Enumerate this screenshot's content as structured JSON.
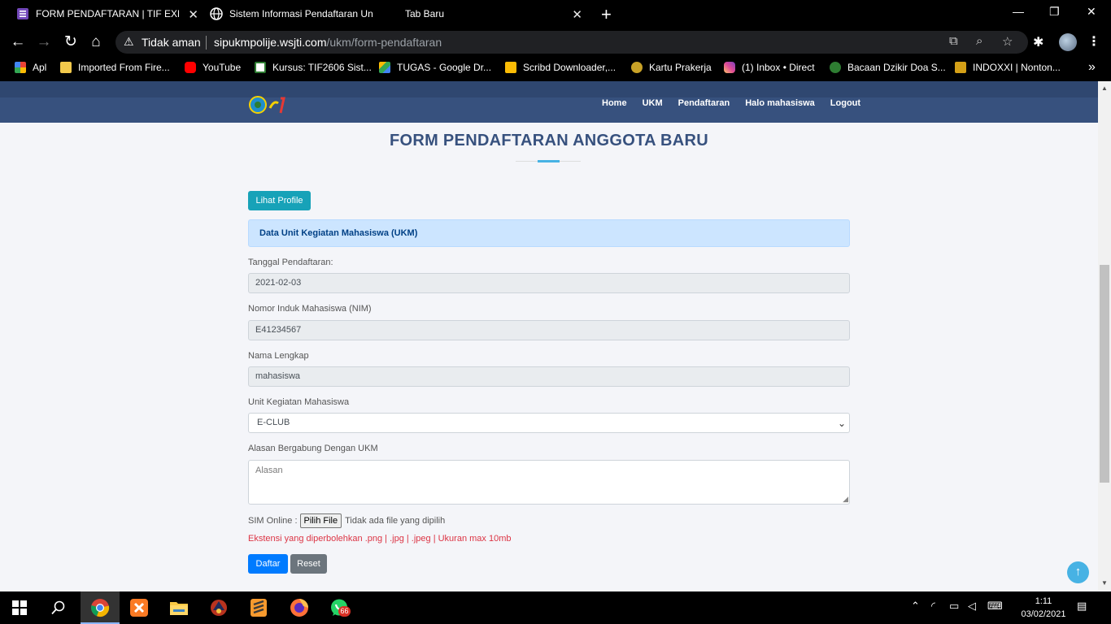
{
  "browser": {
    "tabs": [
      {
        "title": "FORM PENDAFTARAN | TIF EXHIB",
        "icon": "form-icon"
      },
      {
        "title": "Sistem Informasi Pendaftaran Un",
        "icon": "globe-icon"
      },
      {
        "title": "Tab Baru",
        "icon": "none"
      }
    ],
    "security_label": "Tidak aman",
    "url_host": "sipukmpolije.wsjti.com",
    "url_path": "/ukm/form-pendaftaran",
    "bookmarks": [
      {
        "label": "Apl",
        "color": "#ea4335"
      },
      {
        "label": "Imported From Fire...",
        "color": "#f2c94c"
      },
      {
        "label": "YouTube",
        "color": "#ff0000"
      },
      {
        "label": "Kursus: TIF2606 Sist...",
        "color": "#ffffff"
      },
      {
        "label": "TUGAS - Google Dr...",
        "color": "#34a853"
      },
      {
        "label": "Scribd Downloader,...",
        "color": "#fbbc05"
      },
      {
        "label": "Kartu Prakerja",
        "color": "#c9a227"
      },
      {
        "label": "(1) Inbox • Direct",
        "color": "#c13584"
      },
      {
        "label": "Bacaan Dzikir Doa S...",
        "color": "#2e7d32"
      },
      {
        "label": "INDOXXI | Nonton...",
        "color": "#d4a017"
      }
    ]
  },
  "site": {
    "nav": [
      "Home",
      "UKM",
      "Pendaftaran",
      "Halo mahasiswa",
      "Logout"
    ],
    "page_title": "FORM PENDAFTARAN ANGGOTA BARU",
    "profile_button": "Lihat Profile",
    "alert": "Data Unit Kegiatan Mahasiswa (UKM)",
    "form": {
      "date_label": "Tanggal Pendaftaran:",
      "date_value": "2021-02-03",
      "nim_label": "Nomor Induk Mahasiswa (NIM)",
      "nim_value": "E41234567",
      "name_label": "Nama Lengkap",
      "name_value": "mahasiswa",
      "ukm_label": "Unit Kegiatan Mahasiswa",
      "ukm_value": "E-CLUB",
      "reason_label": "Alasan Bergabung Dengan UKM",
      "reason_placeholder": "Alasan",
      "sim_label": "SIM Online :",
      "file_button": "Pilih File",
      "file_status": "Tidak ada file yang dipilih",
      "hint": "Ekstensi yang diperbolehkan .png | .jpg | .jpeg | Ukuran max 10mb",
      "submit": "Daftar",
      "reset": "Reset"
    }
  },
  "taskbar": {
    "time": "1:11",
    "date": "03/02/2021",
    "whatsapp_badge": "66"
  }
}
